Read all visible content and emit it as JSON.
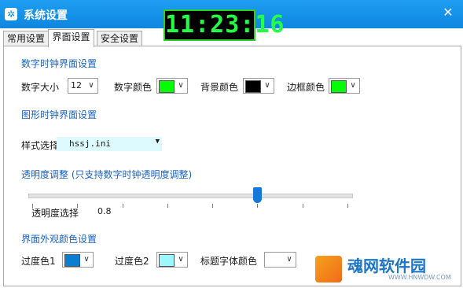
{
  "window": {
    "title": "系统设置",
    "clock_time": "11:23:16"
  },
  "tabs": [
    {
      "label": "常用设置"
    },
    {
      "label": "界面设置",
      "active": true
    },
    {
      "label": "安全设置"
    }
  ],
  "digital": {
    "section_title": "数字时钟界面设置",
    "size_label": "数字大小",
    "size_value": "12",
    "digit_color_label": "数字颜色",
    "digit_color": "#00ff00",
    "bg_color_label": "背景颜色",
    "bg_color": "#000000",
    "border_color_label": "边框颜色",
    "border_color": "#00ff00"
  },
  "graphic": {
    "section_title": "图形时钟界面设置",
    "style_label": "样式选择",
    "style_value": "hssj.ini"
  },
  "transparency": {
    "section_title": "透明度调整  (只支持数字时钟透明度调整)",
    "label": "透明度选择",
    "value": "0.8"
  },
  "appearance": {
    "section_title": "界面外观颜色设置",
    "gradient1_label": "过度色1",
    "gradient1_color": "#0a7fd1",
    "gradient2_label": "过度色2",
    "gradient2_color": "#9ef7ff",
    "title_font_color_label": "标题字体颜色",
    "title_font_color": "#ffffff"
  },
  "watermark": {
    "name": "魂网软件园",
    "url": "WWW.HNWDW.COM"
  }
}
